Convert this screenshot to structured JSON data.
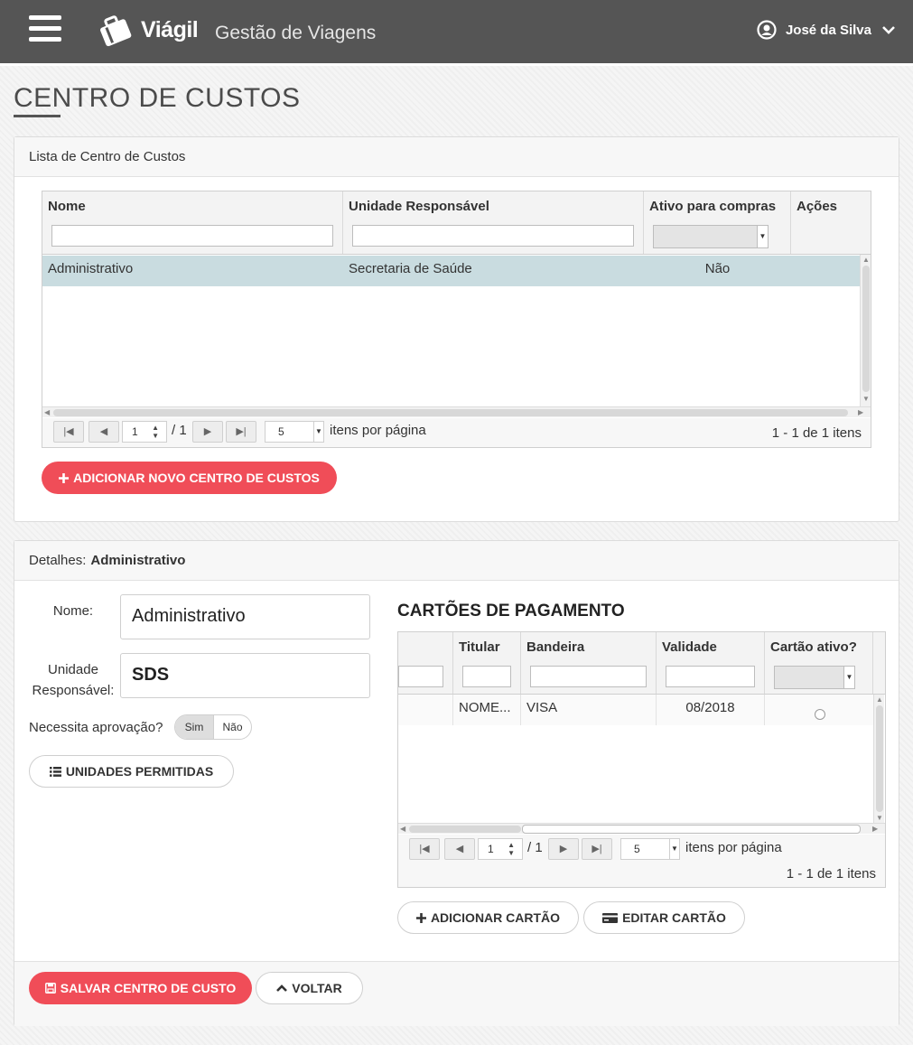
{
  "header": {
    "brand": "Viágil",
    "app_title": "Gestão de Viagens",
    "user_name": "José da Silva"
  },
  "page": {
    "title": "CENTRO DE CUSTOS"
  },
  "list_panel": {
    "title": "Lista de Centro de Custos",
    "columns": [
      "Nome",
      "Unidade Responsável",
      "Ativo para compras",
      "Ações"
    ],
    "rows": [
      {
        "nome": "Administrativo",
        "unidade": "Secretaria de Saúde",
        "ativo": "Não"
      }
    ],
    "pager": {
      "page": "1",
      "total_pages": "/ 1",
      "page_size": "5",
      "page_size_label": "itens por página",
      "info": "1 - 1 de 1 itens"
    },
    "add_button": "ADICIONAR NOVO CENTRO DE CUSTOS"
  },
  "details_panel": {
    "title_prefix": "Detalhes:",
    "title_value": "Administrativo",
    "nome_label": "Nome:",
    "nome_value": "Administrativo",
    "unidade_label_1": "Unidade",
    "unidade_label_2": "Responsável:",
    "unidade_value": "SDS",
    "aprovacao_label": "Necessita aprovação?",
    "toggle_yes": "Sim",
    "toggle_no": "Não",
    "toggle_selected": "Sim",
    "unidades_button": "UNIDADES PERMITIDAS",
    "cards_title": "CARTÕES DE PAGAMENTO",
    "cards_columns": [
      "Titular",
      "Bandeira",
      "Validade",
      "Cartão ativo?"
    ],
    "cards_rows": [
      {
        "titular": "NOME...",
        "bandeira": "VISA",
        "validade": "08/2018"
      }
    ],
    "cards_pager": {
      "page": "1",
      "total_pages": "/ 1",
      "page_size": "5",
      "page_size_label": "itens por página",
      "info": "1 - 1 de 1 itens"
    },
    "add_card_button": "ADICIONAR CARTÃO",
    "edit_card_button": "EDITAR CARTÃO"
  },
  "footer": {
    "save_button": "SALVAR CENTRO DE CUSTO",
    "back_button": "VOLTAR"
  },
  "colors": {
    "primary": "#f04d58",
    "topbar": "#555555",
    "selected_row": "#c9dce0"
  }
}
